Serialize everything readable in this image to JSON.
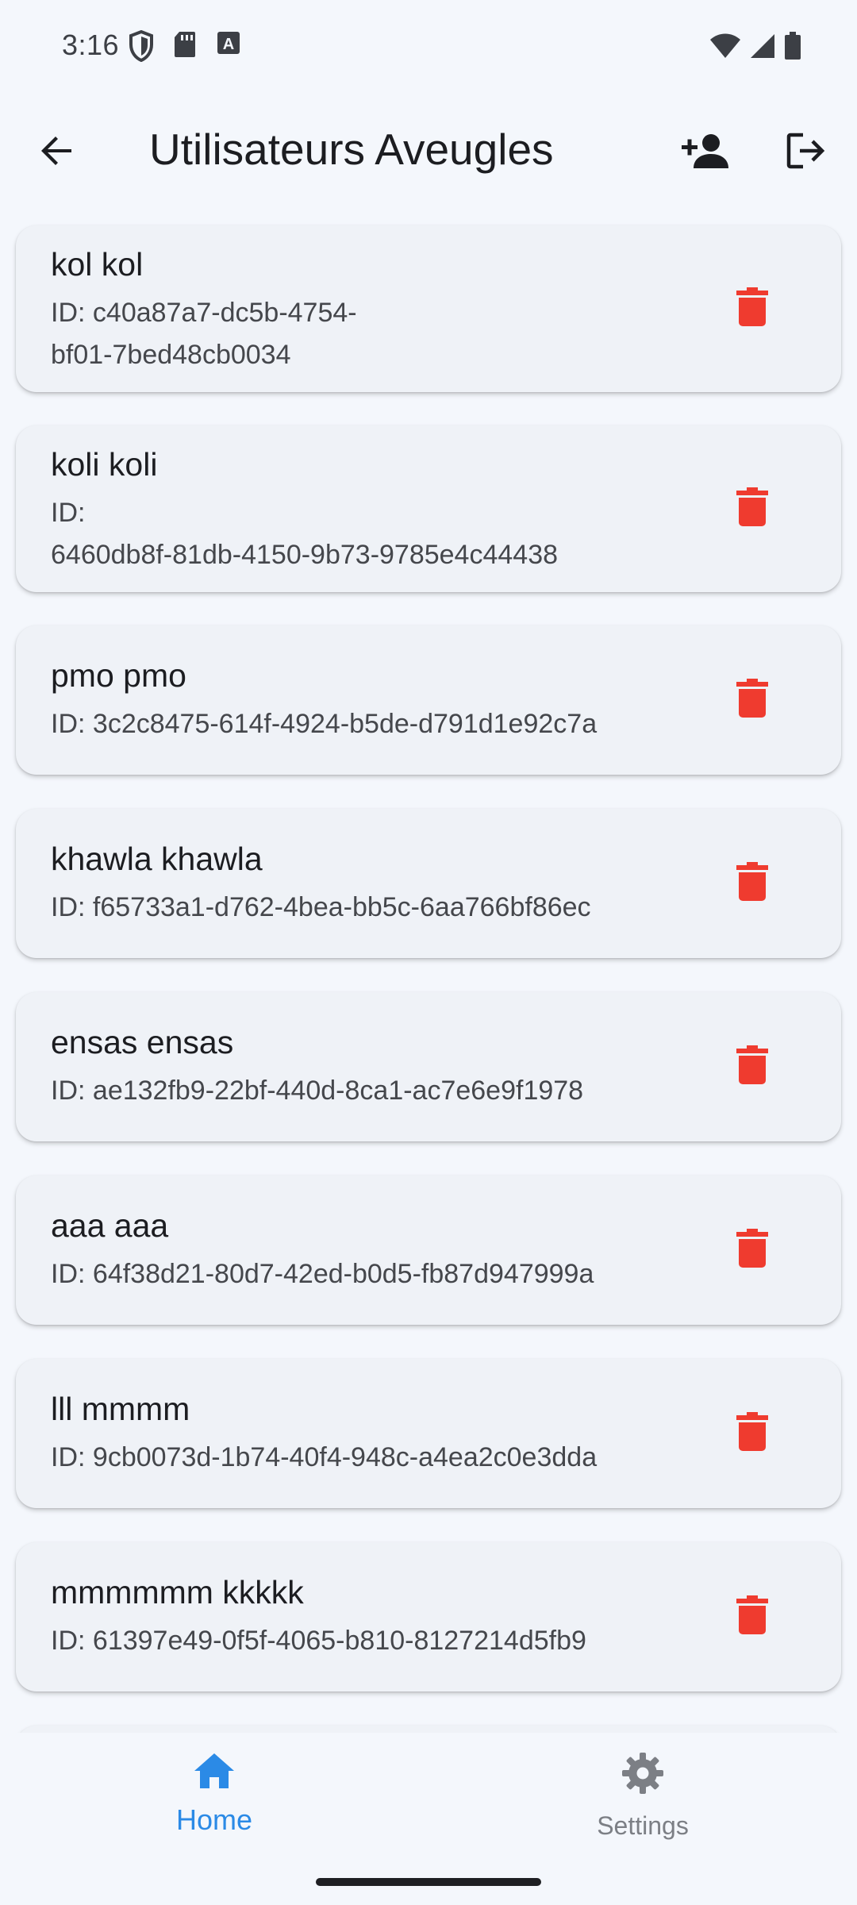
{
  "status_bar": {
    "time": "3:16",
    "left_icons": [
      "shield-icon",
      "sd-card-icon",
      "text-a-icon"
    ],
    "right_icons": [
      "wifi-icon",
      "signal-icon",
      "battery-icon"
    ]
  },
  "app_bar": {
    "title": "Utilisateurs Aveugles",
    "back_icon": "arrow-left-icon",
    "add_user_icon": "person-add-icon",
    "logout_icon": "logout-icon"
  },
  "users": [
    {
      "name": "kol kol",
      "id_prefix": "ID:",
      "id": "c40a87a7-dc5b-4754-bf01-7bed48cb0034"
    },
    {
      "name": "koli koli",
      "id_prefix": "ID:",
      "id": "6460db8f-81db-4150-9b73-9785e4c44438"
    },
    {
      "name": "pmo pmo",
      "id_prefix": "ID:",
      "id": "3c2c8475-614f-4924-b5de-d791d1e92c7a"
    },
    {
      "name": "khawla khawla",
      "id_prefix": "ID:",
      "id": "f65733a1-d762-4bea-bb5c-6aa766bf86ec"
    },
    {
      "name": "ensas ensas",
      "id_prefix": "ID:",
      "id": "ae132fb9-22bf-440d-8ca1-ac7e6e9f1978"
    },
    {
      "name": "aaa aaa",
      "id_prefix": "ID:",
      "id": "64f38d21-80d7-42ed-b0d5-fb87d947999a"
    },
    {
      "name": "lll mmmm",
      "id_prefix": "ID:",
      "id": "9cb0073d-1b74-40f4-948c-a4ea2c0e3dda"
    },
    {
      "name": "mmmmmm kkkkk",
      "id_prefix": "ID:",
      "id": "61397e49-0f5f-4065-b810-8127214d5fb9"
    }
  ],
  "bottom_nav": {
    "items": [
      {
        "label": "Home",
        "icon": "home-icon",
        "active": true
      },
      {
        "label": "Settings",
        "icon": "gear-icon",
        "active": false
      }
    ]
  },
  "colors": {
    "background": "#f4f7fc",
    "card": "#eff2f7",
    "delete": "#ef3b2f",
    "accent": "#2b8ae6",
    "inactive": "#7c7f85"
  }
}
